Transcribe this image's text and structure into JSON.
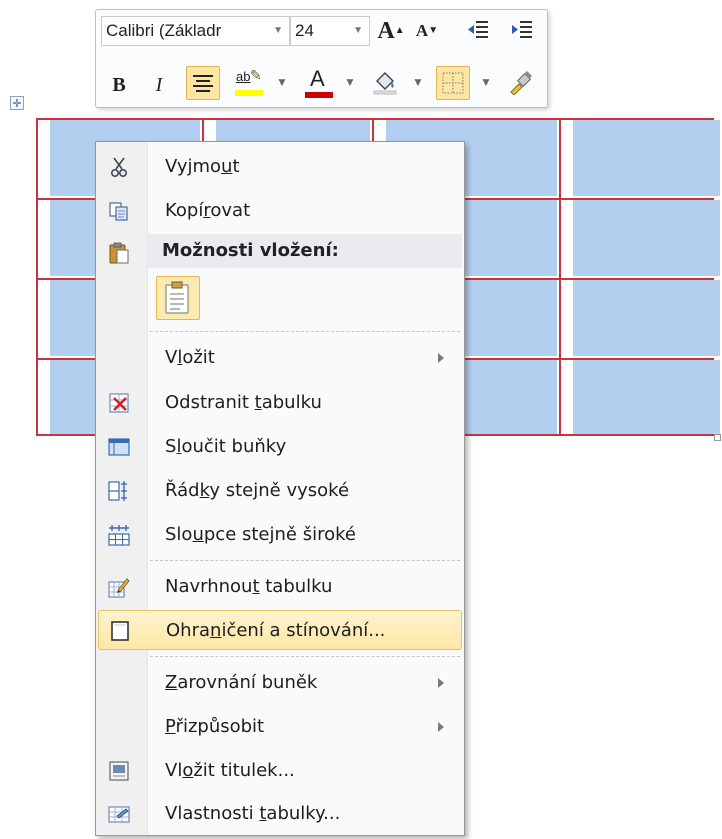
{
  "toolbar": {
    "font_name": "Calibri (Základr",
    "font_size": "24",
    "grow_font": "A",
    "shrink_font": "A",
    "bold": "B",
    "italic": "I",
    "font_color_letter": "A",
    "highlight_text": "ab",
    "colors": {
      "highlight": "#ffff00",
      "font": "#cc0000",
      "accent": "#fde5a3"
    }
  },
  "menu": {
    "cut": "Vyjmout",
    "copy": "Kopírovat",
    "paste_options_header": "Možnosti vložení:",
    "insert": "Vložit",
    "delete_table": "Odstranit tabulku",
    "merge_cells": "Sloučit buňky",
    "distribute_rows": "Řádky stejně vysoké",
    "distribute_columns": "Sloupce stejně široké",
    "draw_table": "Navrhnout tabulku",
    "borders_shading": "Ohraničení a stínování...",
    "cell_alignment": "Zarovnání buněk",
    "autofit": "Přizpůsobit",
    "insert_caption": "Vložit titulek...",
    "table_properties": "Vlastnosti tabulky..."
  },
  "table": {
    "rows": 4,
    "columns": 4,
    "selection_color": "#b3cff0",
    "border_color": "#cc3340"
  }
}
